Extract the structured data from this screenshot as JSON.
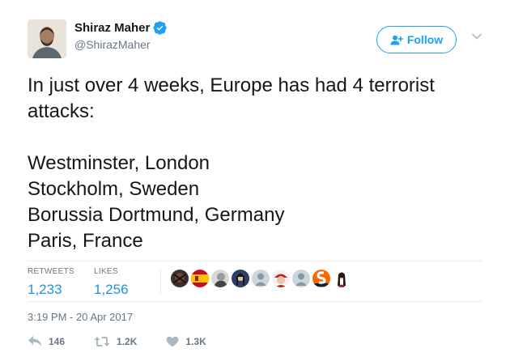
{
  "user": {
    "display_name": "Shiraz Maher",
    "handle": "@ShirazMaher",
    "verified": true
  },
  "follow_button": {
    "label": "Follow"
  },
  "tweet": {
    "text": "In just over 4 weeks, Europe has had 4 terrorist attacks:\n\nWestminster, London\nStockholm, Sweden\nBorussia Dortmund, Germany\nParis, France"
  },
  "stats": {
    "retweets_label": "RETWEETS",
    "retweets_value": "1,233",
    "likes_label": "LIKES",
    "likes_value": "1,256"
  },
  "timestamp": "3:19 PM - 20 Apr 2017",
  "actions": {
    "reply_count": "146",
    "retweet_count": "1.2K",
    "like_count": "1.3K"
  },
  "colors": {
    "accent": "#1da1f2",
    "stat_value": "#1b95e0",
    "muted": "#657786",
    "text": "#14171a"
  }
}
